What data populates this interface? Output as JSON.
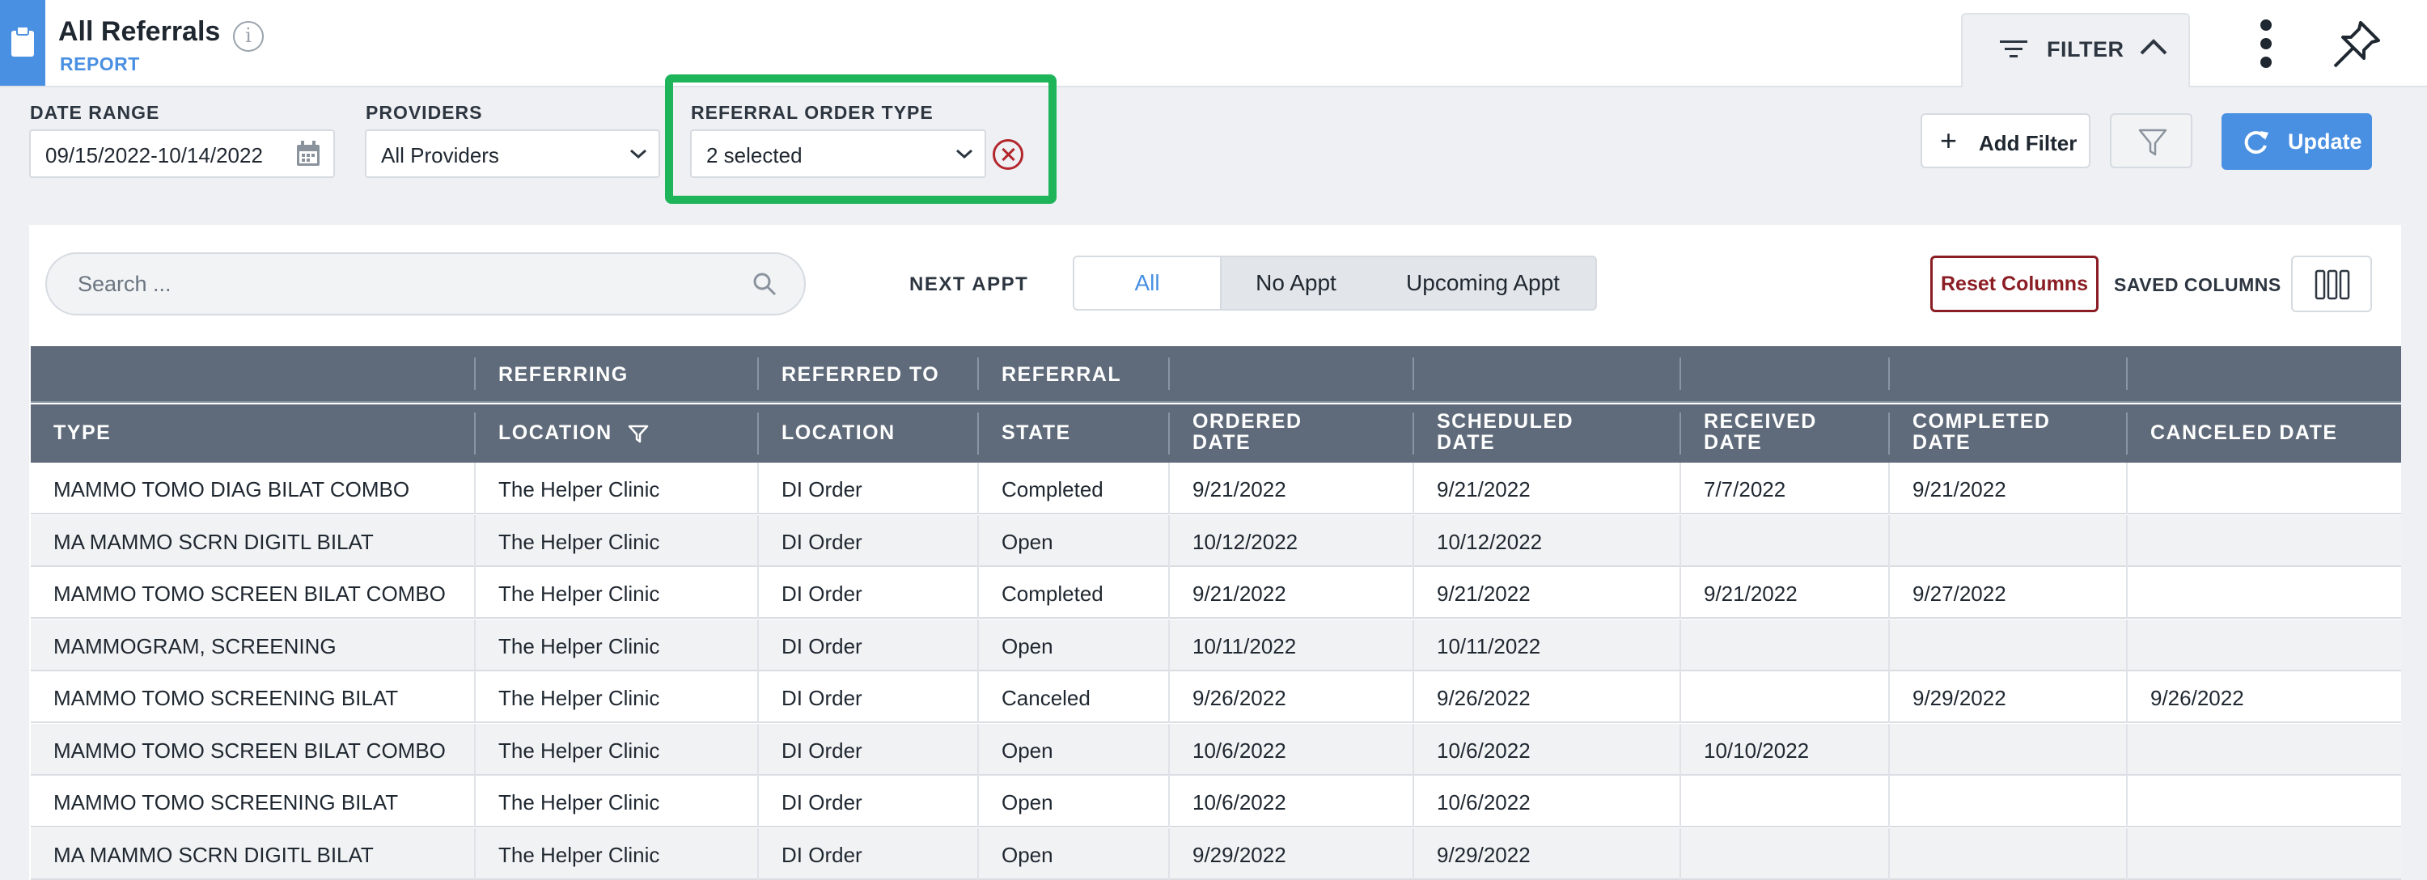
{
  "header": {
    "title": "All Referrals",
    "subtitle": "REPORT",
    "filter_label": "FILTER"
  },
  "filters": {
    "date_range": {
      "label": "DATE RANGE",
      "value": "09/15/2022-10/14/2022"
    },
    "providers": {
      "label": "PROVIDERS",
      "value": "All Providers"
    },
    "referral_order_type": {
      "label": "REFERRAL ORDER TYPE",
      "value": "2 selected"
    },
    "add_filter_label": "Add Filter",
    "update_label": "Update"
  },
  "toolbar": {
    "search_placeholder": "Search ...",
    "next_appt_label": "NEXT APPT",
    "segments": [
      "All",
      "No Appt",
      "Upcoming Appt"
    ],
    "active_segment": "All",
    "reset_columns_label": "Reset Columns",
    "saved_columns_label": "SAVED COLUMNS"
  },
  "table": {
    "group_headers": [
      "",
      "REFERRING",
      "REFERRED TO",
      "REFERRAL",
      "",
      "",
      "",
      "",
      ""
    ],
    "columns": [
      [
        "TYPE"
      ],
      [
        "LOCATION"
      ],
      [
        "LOCATION"
      ],
      [
        "STATE"
      ],
      [
        "ORDERED",
        "DATE"
      ],
      [
        "SCHEDULED",
        "DATE"
      ],
      [
        "RECEIVED",
        "DATE"
      ],
      [
        "COMPLETED",
        "DATE"
      ],
      [
        "CANCELED DATE"
      ]
    ],
    "rows": [
      [
        "MAMMO TOMO DIAG BILAT COMBO",
        "The Helper Clinic",
        "DI Order",
        "Completed",
        "9/21/2022",
        "9/21/2022",
        "7/7/2022",
        "9/21/2022",
        ""
      ],
      [
        "MA MAMMO SCRN DIGITL BILAT",
        "The Helper Clinic",
        "DI Order",
        "Open",
        "10/12/2022",
        "10/12/2022",
        "",
        "",
        ""
      ],
      [
        "MAMMO TOMO SCREEN BILAT COMBO",
        "The Helper Clinic",
        "DI Order",
        "Completed",
        "9/21/2022",
        "9/21/2022",
        "9/21/2022",
        "9/27/2022",
        ""
      ],
      [
        "MAMMOGRAM, SCREENING",
        "The Helper Clinic",
        "DI Order",
        "Open",
        "10/11/2022",
        "10/11/2022",
        "",
        "",
        ""
      ],
      [
        "MAMMO TOMO SCREENING BILAT",
        "The Helper Clinic",
        "DI Order",
        "Canceled",
        "9/26/2022",
        "9/26/2022",
        "",
        "9/29/2022",
        "9/26/2022"
      ],
      [
        "MAMMO TOMO SCREEN BILAT COMBO",
        "The Helper Clinic",
        "DI Order",
        "Open",
        "10/6/2022",
        "10/6/2022",
        "10/10/2022",
        "",
        ""
      ],
      [
        "MAMMO TOMO SCREENING BILAT",
        "The Helper Clinic",
        "DI Order",
        "Open",
        "10/6/2022",
        "10/6/2022",
        "",
        "",
        ""
      ],
      [
        "MA MAMMO SCRN DIGITL BILAT",
        "The Helper Clinic",
        "DI Order",
        "Open",
        "9/29/2022",
        "9/29/2022",
        "",
        "",
        ""
      ]
    ]
  },
  "colors": {
    "accent": "#4a90e2",
    "header_row": "#5f6b7a",
    "highlight": "#1db45a",
    "danger": "#b3262d"
  },
  "icons": [
    "clipboard-icon",
    "info-icon",
    "filter-lines-icon",
    "chevron-up-icon",
    "kebab-menu-icon",
    "pin-icon",
    "calendar-icon",
    "chevron-down-icon",
    "clear-icon",
    "plus-icon",
    "funnel-icon",
    "refresh-icon",
    "search-icon",
    "columns-icon"
  ]
}
